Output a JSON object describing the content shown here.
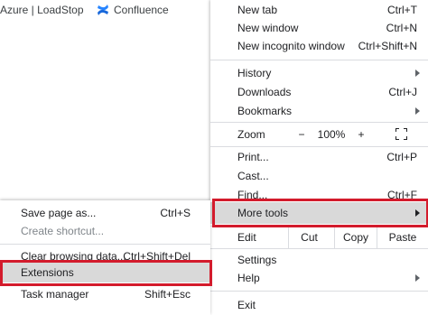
{
  "bookmarks": [
    {
      "label": "Azure | LoadStop",
      "icon": "azure-icon"
    },
    {
      "label": "Confluence",
      "icon": "confluence-icon"
    }
  ],
  "menu": {
    "new_tab": {
      "label": "New tab",
      "shortcut": "Ctrl+T"
    },
    "new_window": {
      "label": "New window",
      "shortcut": "Ctrl+N"
    },
    "new_incognito": {
      "label": "New incognito window",
      "shortcut": "Ctrl+Shift+N"
    },
    "history": {
      "label": "History"
    },
    "downloads": {
      "label": "Downloads",
      "shortcut": "Ctrl+J"
    },
    "bookmarks": {
      "label": "Bookmarks"
    },
    "zoom": {
      "label": "Zoom",
      "minus": "−",
      "value": "100%",
      "plus": "+"
    },
    "print": {
      "label": "Print...",
      "shortcut": "Ctrl+P"
    },
    "cast": {
      "label": "Cast..."
    },
    "find": {
      "label": "Find...",
      "shortcut": "Ctrl+F"
    },
    "more_tools": {
      "label": "More tools"
    },
    "edit": {
      "label": "Edit",
      "cut": "Cut",
      "copy": "Copy",
      "paste": "Paste"
    },
    "settings": {
      "label": "Settings"
    },
    "help": {
      "label": "Help"
    },
    "exit": {
      "label": "Exit"
    }
  },
  "submenu": {
    "save_page": {
      "label": "Save page as...",
      "shortcut": "Ctrl+S"
    },
    "create_shortcut": {
      "label": "Create shortcut..."
    },
    "clear_browsing": {
      "label": "Clear browsing data...",
      "shortcut": "Ctrl+Shift+Del"
    },
    "extensions": {
      "label": "Extensions"
    },
    "task_manager": {
      "label": "Task manager",
      "shortcut": "Shift+Esc"
    }
  },
  "colors": {
    "highlight_frame": "#d31b2c",
    "hover": "#d9d9d9",
    "confluence_blue": "#1868db",
    "azure_blue": "#0078d4"
  }
}
